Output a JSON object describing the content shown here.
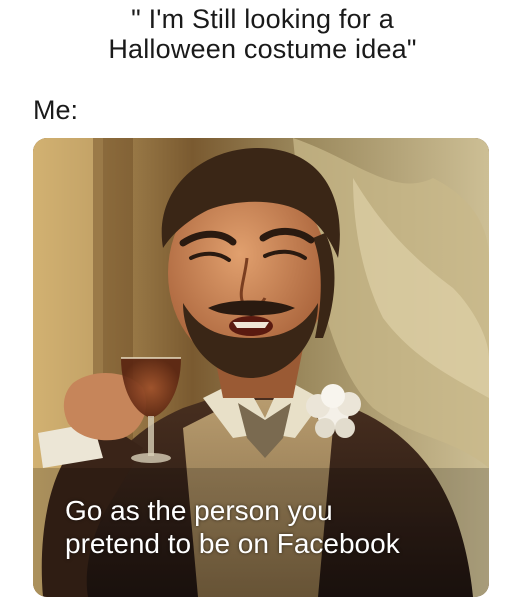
{
  "meme": {
    "top_caption_line1": "\" I'm Still looking for a",
    "top_caption_line2": "Halloween costume idea\"",
    "me_label": "Me:",
    "image_caption_line1": "Go as the person you",
    "image_caption_line2": "pretend to be on Facebook"
  },
  "colors": {
    "background": "#ffffff",
    "text": "#1a1a1a",
    "overlay_text": "#ffffff",
    "room_backdrop": "#8a6a3a",
    "jacket": "#3a2418",
    "flower": "#f4f0e8"
  }
}
